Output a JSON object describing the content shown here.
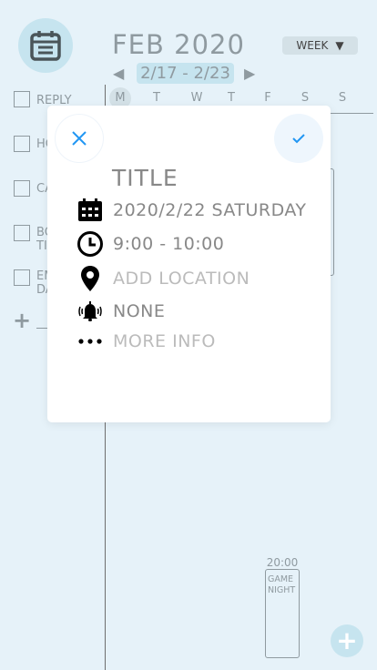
{
  "header": {
    "month": "FEB 2020",
    "view_select": "WEEK",
    "range": "2/17 - 2/23",
    "prev_icon": "triangle-left",
    "next_icon": "triangle-right"
  },
  "days": [
    "M",
    "T",
    "W",
    "T",
    "F",
    "S",
    "S"
  ],
  "sidebar": {
    "tasks": [
      {
        "label": "REPLY"
      },
      {
        "label": "HO"
      },
      {
        "label": "CA"
      },
      {
        "label": "BO\nTI"
      },
      {
        "label": "EM\nDA"
      }
    ]
  },
  "events": [
    {
      "time": "20:00",
      "title": "GAME NIGHT"
    }
  ],
  "modal": {
    "title_placeholder": "TITLE",
    "date": "2020/2/22 SATURDAY",
    "time": "9:00 - 10:00",
    "location_placeholder": "ADD LOCATION",
    "reminder": "NONE",
    "more_placeholder": "MORE INFO"
  },
  "colors": {
    "background": "#e6f2f9",
    "accent_light": "#c6e4ef",
    "accent_blue": "#2196f3",
    "text_gray": "#8f9aa0"
  }
}
